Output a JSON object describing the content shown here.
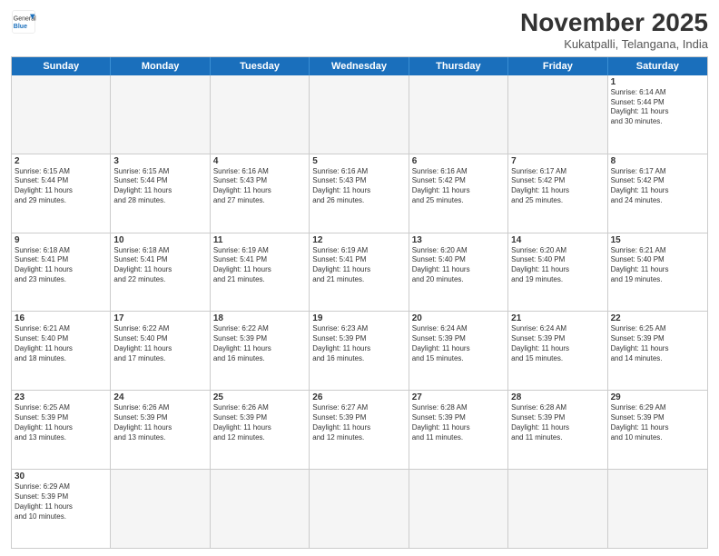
{
  "header": {
    "logo_general": "General",
    "logo_blue": "Blue",
    "month_title": "November 2025",
    "subtitle": "Kukatpalli, Telangana, India"
  },
  "days": [
    "Sunday",
    "Monday",
    "Tuesday",
    "Wednesday",
    "Thursday",
    "Friday",
    "Saturday"
  ],
  "weeks": [
    [
      {
        "day": "",
        "info": ""
      },
      {
        "day": "",
        "info": ""
      },
      {
        "day": "",
        "info": ""
      },
      {
        "day": "",
        "info": ""
      },
      {
        "day": "",
        "info": ""
      },
      {
        "day": "",
        "info": ""
      },
      {
        "day": "1",
        "info": "Sunrise: 6:14 AM\nSunset: 5:44 PM\nDaylight: 11 hours\nand 30 minutes."
      }
    ],
    [
      {
        "day": "2",
        "info": "Sunrise: 6:15 AM\nSunset: 5:44 PM\nDaylight: 11 hours\nand 29 minutes."
      },
      {
        "day": "3",
        "info": "Sunrise: 6:15 AM\nSunset: 5:44 PM\nDaylight: 11 hours\nand 28 minutes."
      },
      {
        "day": "4",
        "info": "Sunrise: 6:16 AM\nSunset: 5:43 PM\nDaylight: 11 hours\nand 27 minutes."
      },
      {
        "day": "5",
        "info": "Sunrise: 6:16 AM\nSunset: 5:43 PM\nDaylight: 11 hours\nand 26 minutes."
      },
      {
        "day": "6",
        "info": "Sunrise: 6:16 AM\nSunset: 5:42 PM\nDaylight: 11 hours\nand 25 minutes."
      },
      {
        "day": "7",
        "info": "Sunrise: 6:17 AM\nSunset: 5:42 PM\nDaylight: 11 hours\nand 25 minutes."
      },
      {
        "day": "8",
        "info": "Sunrise: 6:17 AM\nSunset: 5:42 PM\nDaylight: 11 hours\nand 24 minutes."
      }
    ],
    [
      {
        "day": "9",
        "info": "Sunrise: 6:18 AM\nSunset: 5:41 PM\nDaylight: 11 hours\nand 23 minutes."
      },
      {
        "day": "10",
        "info": "Sunrise: 6:18 AM\nSunset: 5:41 PM\nDaylight: 11 hours\nand 22 minutes."
      },
      {
        "day": "11",
        "info": "Sunrise: 6:19 AM\nSunset: 5:41 PM\nDaylight: 11 hours\nand 21 minutes."
      },
      {
        "day": "12",
        "info": "Sunrise: 6:19 AM\nSunset: 5:41 PM\nDaylight: 11 hours\nand 21 minutes."
      },
      {
        "day": "13",
        "info": "Sunrise: 6:20 AM\nSunset: 5:40 PM\nDaylight: 11 hours\nand 20 minutes."
      },
      {
        "day": "14",
        "info": "Sunrise: 6:20 AM\nSunset: 5:40 PM\nDaylight: 11 hours\nand 19 minutes."
      },
      {
        "day": "15",
        "info": "Sunrise: 6:21 AM\nSunset: 5:40 PM\nDaylight: 11 hours\nand 19 minutes."
      }
    ],
    [
      {
        "day": "16",
        "info": "Sunrise: 6:21 AM\nSunset: 5:40 PM\nDaylight: 11 hours\nand 18 minutes."
      },
      {
        "day": "17",
        "info": "Sunrise: 6:22 AM\nSunset: 5:40 PM\nDaylight: 11 hours\nand 17 minutes."
      },
      {
        "day": "18",
        "info": "Sunrise: 6:22 AM\nSunset: 5:39 PM\nDaylight: 11 hours\nand 16 minutes."
      },
      {
        "day": "19",
        "info": "Sunrise: 6:23 AM\nSunset: 5:39 PM\nDaylight: 11 hours\nand 16 minutes."
      },
      {
        "day": "20",
        "info": "Sunrise: 6:24 AM\nSunset: 5:39 PM\nDaylight: 11 hours\nand 15 minutes."
      },
      {
        "day": "21",
        "info": "Sunrise: 6:24 AM\nSunset: 5:39 PM\nDaylight: 11 hours\nand 15 minutes."
      },
      {
        "day": "22",
        "info": "Sunrise: 6:25 AM\nSunset: 5:39 PM\nDaylight: 11 hours\nand 14 minutes."
      }
    ],
    [
      {
        "day": "23",
        "info": "Sunrise: 6:25 AM\nSunset: 5:39 PM\nDaylight: 11 hours\nand 13 minutes."
      },
      {
        "day": "24",
        "info": "Sunrise: 6:26 AM\nSunset: 5:39 PM\nDaylight: 11 hours\nand 13 minutes."
      },
      {
        "day": "25",
        "info": "Sunrise: 6:26 AM\nSunset: 5:39 PM\nDaylight: 11 hours\nand 12 minutes."
      },
      {
        "day": "26",
        "info": "Sunrise: 6:27 AM\nSunset: 5:39 PM\nDaylight: 11 hours\nand 12 minutes."
      },
      {
        "day": "27",
        "info": "Sunrise: 6:28 AM\nSunset: 5:39 PM\nDaylight: 11 hours\nand 11 minutes."
      },
      {
        "day": "28",
        "info": "Sunrise: 6:28 AM\nSunset: 5:39 PM\nDaylight: 11 hours\nand 11 minutes."
      },
      {
        "day": "29",
        "info": "Sunrise: 6:29 AM\nSunset: 5:39 PM\nDaylight: 11 hours\nand 10 minutes."
      }
    ],
    [
      {
        "day": "30",
        "info": "Sunrise: 6:29 AM\nSunset: 5:39 PM\nDaylight: 11 hours\nand 10 minutes."
      },
      {
        "day": "",
        "info": ""
      },
      {
        "day": "",
        "info": ""
      },
      {
        "day": "",
        "info": ""
      },
      {
        "day": "",
        "info": ""
      },
      {
        "day": "",
        "info": ""
      },
      {
        "day": "",
        "info": ""
      }
    ]
  ]
}
